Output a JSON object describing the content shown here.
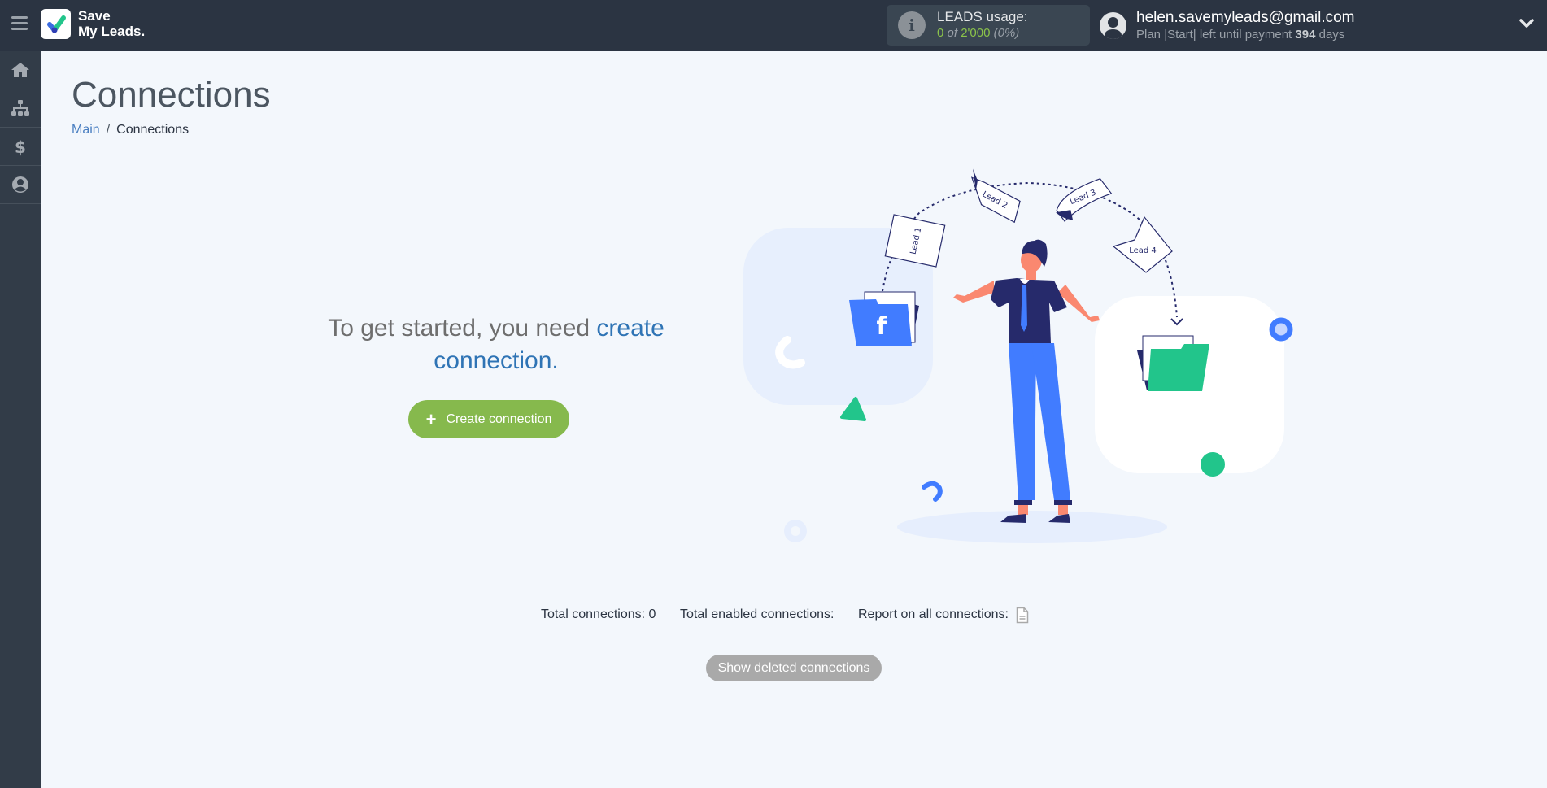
{
  "header": {
    "logo_line1": "Save",
    "logo_line2": "My Leads.",
    "leads_usage_label": "LEADS usage:",
    "leads_used": "0",
    "leads_of": "of",
    "leads_limit": "2'000",
    "leads_percent": "(0%)",
    "user_email": "helen.savemyleads@gmail.com",
    "plan_prefix": "Plan |Start| left until payment",
    "plan_days": "394",
    "plan_suffix": "days"
  },
  "sidebar": {
    "items": [
      {
        "name": "home",
        "icon": "home-icon"
      },
      {
        "name": "connections",
        "icon": "sitemap-icon"
      },
      {
        "name": "billing",
        "icon": "dollar-icon"
      },
      {
        "name": "account",
        "icon": "user-circle-icon"
      }
    ]
  },
  "page": {
    "title": "Connections",
    "breadcrumb": [
      {
        "label": "Main",
        "link": true
      },
      {
        "label": "Connections",
        "link": false
      }
    ],
    "intro_text": "To get started, you need ",
    "intro_link": "create connection",
    "intro_end": ".",
    "create_button": "Create connection",
    "stats": {
      "total_label": "Total connections: 0",
      "enabled_label": "Total enabled connections:",
      "report_label": "Report on all connections:"
    },
    "show_deleted_button": "Show deleted connections"
  },
  "illustration": {
    "leads": [
      "Lead 1",
      "Lead 2",
      "Lead 3",
      "Lead 4"
    ],
    "source_icon": "facebook-icon",
    "colors": {
      "accent_blue": "#417cff",
      "accent_green": "#22c58b",
      "navy": "#262a6b",
      "skin": "#fa8870"
    }
  },
  "colors": {
    "header_bg": "#2b3442",
    "sidebar_bg": "#323c48",
    "page_bg": "#f3f7fc",
    "create_button_bg": "#86b94d",
    "link_blue": "#2f74b5",
    "usage_green": "#8bc34a"
  }
}
